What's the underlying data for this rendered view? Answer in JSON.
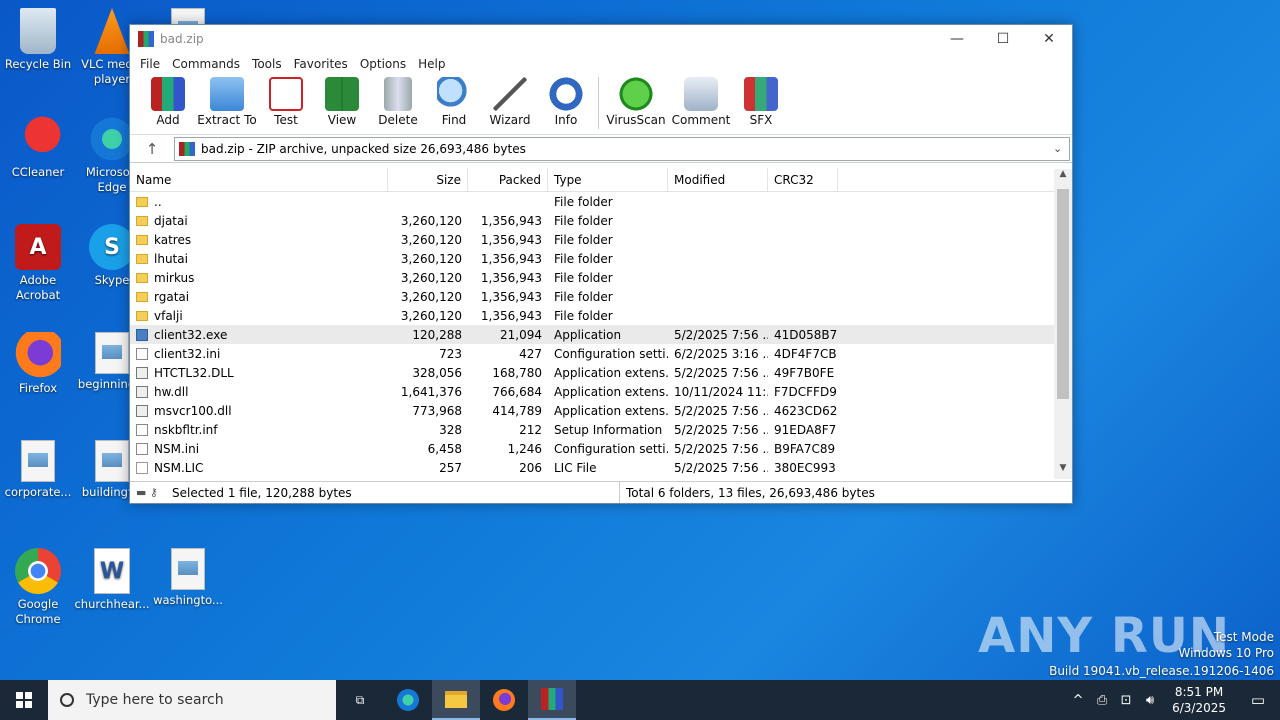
{
  "desktop": {
    "icons": [
      {
        "label": "Recycle Bin"
      },
      {
        "label": "VLC media player"
      },
      {
        "label": "CCleaner"
      },
      {
        "label": "Microsoft Edge"
      },
      {
        "label": "Adobe Acrobat"
      },
      {
        "label": "Skype"
      },
      {
        "label": "Firefox"
      },
      {
        "label": "beginning..."
      },
      {
        "label": "corporate..."
      },
      {
        "label": "buildingf..."
      },
      {
        "label": "Google Chrome"
      },
      {
        "label": "churchhear..."
      },
      {
        "label": "washingto..."
      }
    ]
  },
  "window": {
    "title": "bad.zip",
    "minimize": "—",
    "maximize": "☐",
    "close": "✕",
    "menu": [
      "File",
      "Commands",
      "Tools",
      "Favorites",
      "Options",
      "Help"
    ],
    "toolbar": [
      "Add",
      "Extract To",
      "Test",
      "View",
      "Delete",
      "Find",
      "Wizard",
      "Info",
      "VirusScan",
      "Comment",
      "SFX"
    ],
    "address": "bad.zip - ZIP archive, unpacked size 26,693,486 bytes",
    "columns": {
      "name": "Name",
      "size": "Size",
      "packed": "Packed",
      "type": "Type",
      "modified": "Modified",
      "crc": "CRC32"
    },
    "rows": [
      {
        "name": "..",
        "size": "",
        "packed": "",
        "type": "File folder",
        "modified": "",
        "crc": ""
      },
      {
        "name": "djatai",
        "size": "3,260,120",
        "packed": "1,356,943",
        "type": "File folder",
        "modified": "",
        "crc": ""
      },
      {
        "name": "katres",
        "size": "3,260,120",
        "packed": "1,356,943",
        "type": "File folder",
        "modified": "",
        "crc": ""
      },
      {
        "name": "lhutai",
        "size": "3,260,120",
        "packed": "1,356,943",
        "type": "File folder",
        "modified": "",
        "crc": ""
      },
      {
        "name": "mirkus",
        "size": "3,260,120",
        "packed": "1,356,943",
        "type": "File folder",
        "modified": "",
        "crc": ""
      },
      {
        "name": "rgatai",
        "size": "3,260,120",
        "packed": "1,356,943",
        "type": "File folder",
        "modified": "",
        "crc": ""
      },
      {
        "name": "vfalji",
        "size": "3,260,120",
        "packed": "1,356,943",
        "type": "File folder",
        "modified": "",
        "crc": ""
      },
      {
        "name": "client32.exe",
        "size": "120,288",
        "packed": "21,094",
        "type": "Application",
        "modified": "5/2/2025 7:56 ...",
        "crc": "41D058B7"
      },
      {
        "name": "client32.ini",
        "size": "723",
        "packed": "427",
        "type": "Configuration setti...",
        "modified": "6/2/2025 3:16 ...",
        "crc": "4DF4F7CB"
      },
      {
        "name": "HTCTL32.DLL",
        "size": "328,056",
        "packed": "168,780",
        "type": "Application extens...",
        "modified": "5/2/2025 7:56 ...",
        "crc": "49F7B0FE"
      },
      {
        "name": "hw.dll",
        "size": "1,641,376",
        "packed": "766,684",
        "type": "Application extens...",
        "modified": "10/11/2024 11:...",
        "crc": "F7DCFFD9"
      },
      {
        "name": "msvcr100.dll",
        "size": "773,968",
        "packed": "414,789",
        "type": "Application extens...",
        "modified": "5/2/2025 7:56 ...",
        "crc": "4623CD62"
      },
      {
        "name": "nskbfltr.inf",
        "size": "328",
        "packed": "212",
        "type": "Setup Information",
        "modified": "5/2/2025 7:56 ...",
        "crc": "91EDA8F7"
      },
      {
        "name": "NSM.ini",
        "size": "6,458",
        "packed": "1,246",
        "type": "Configuration setti...",
        "modified": "5/2/2025 7:56 ...",
        "crc": "B9FA7C89"
      },
      {
        "name": "NSM.LIC",
        "size": "257",
        "packed": "206",
        "type": "LIC File",
        "modified": "5/2/2025 7:56 ...",
        "crc": "380EC993"
      }
    ],
    "status_left": "Selected 1 file, 120,288 bytes",
    "status_right": "Total 6 folders, 13 files, 26,693,486 bytes"
  },
  "watermark": {
    "logo": "ANY RUN",
    "line1": "Test Mode",
    "line2": "Windows 10 Pro",
    "line3": "Build 19041.vb_release.191206-1406"
  },
  "taskbar": {
    "search_placeholder": "Type here to search",
    "time": "8:51 PM",
    "date": "6/3/2025"
  }
}
